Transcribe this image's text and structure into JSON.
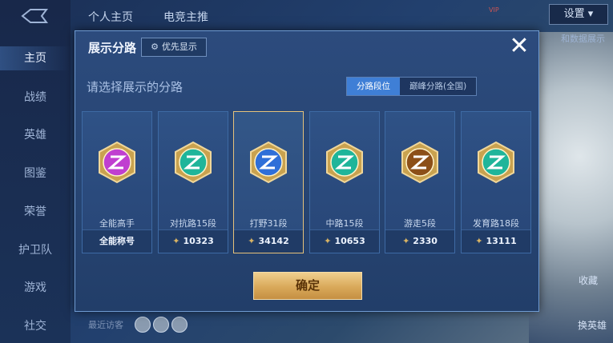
{
  "background": {
    "sidebar_items": [
      "主页",
      "战绩",
      "英雄",
      "图鉴",
      "荣誉",
      "护卫队",
      "游戏",
      "社交"
    ],
    "top_tabs": [
      "个人主页",
      "电竞主推"
    ],
    "settings_label": "设置",
    "vip_label": "VIP",
    "right_side_btn1": "收藏",
    "right_side_btn2": "换英雄",
    "data_show_label": "和数据展示",
    "visitors_label": "最近访客"
  },
  "modal": {
    "title": "展示分路",
    "priority_label": "优先显示",
    "close_icon": "close-icon",
    "prompt": "请选择展示的分路",
    "segment": {
      "tab_on": "分路段位",
      "tab_off": "巅峰分路(全国)"
    },
    "confirm_label": "确定",
    "cards": [
      {
        "label": "全能高手",
        "footer": "全能称号",
        "show_icon": false,
        "badge_color": "#c03fd0",
        "badge_icon": "all-round-badge-icon"
      },
      {
        "label": "对抗路15段",
        "footer": "10323",
        "show_icon": true,
        "badge_color": "#1fb59a",
        "badge_icon": "clash-lane-badge-icon"
      },
      {
        "label": "打野31段",
        "footer": "34142",
        "show_icon": true,
        "badge_color": "#2f6fd8",
        "badge_icon": "jungle-badge-icon"
      },
      {
        "label": "中路15段",
        "footer": "10653",
        "show_icon": true,
        "badge_color": "#1fb59a",
        "badge_icon": "mid-lane-badge-icon"
      },
      {
        "label": "游走5段",
        "footer": "2330",
        "show_icon": true,
        "badge_color": "#8c4f18",
        "badge_icon": "roam-badge-icon"
      },
      {
        "label": "发育路18段",
        "footer": "13111",
        "show_icon": true,
        "badge_color": "#1fb59a",
        "badge_icon": "farm-lane-badge-icon"
      }
    ]
  }
}
